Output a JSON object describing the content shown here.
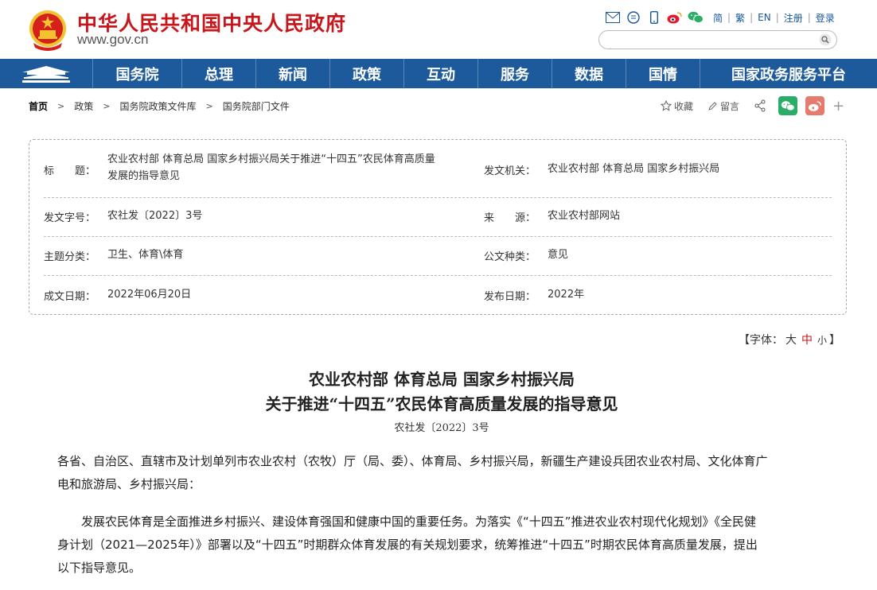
{
  "header": {
    "site_title": "中华人民共和国中央人民政府",
    "site_url": "www.gov.cn",
    "links": {
      "simplified": "简",
      "traditional": "繁",
      "english": "EN",
      "register": "注册",
      "login": "登录"
    },
    "search_placeholder": ""
  },
  "nav": {
    "items": [
      "国务院",
      "总理",
      "新闻",
      "政策",
      "互动",
      "服务",
      "数据",
      "国情",
      "国家政务服务平台"
    ]
  },
  "breadcrumb": {
    "items": [
      "首页",
      "政策",
      "国务院政策文件库",
      "国务院部门文件"
    ]
  },
  "share": {
    "favorite": "收藏",
    "comment": "留言"
  },
  "info": {
    "title_label": "标　　题：",
    "title_value_line1": "农业农村部 体育总局 国家乡村振兴局关于推进“十四五”农民体育高质量",
    "title_value_line2": "发展的指导意见",
    "issuer_label": "发文机关：",
    "issuer_value": "农业农村部 体育总局 国家乡村振兴局",
    "docno_label": "发文字号：",
    "docno_value": "农社发〔2022〕3号",
    "source_label": "来　　源：",
    "source_value": "农业农村部网站",
    "topic_label": "主题分类：",
    "topic_value": "卫生、体育\\体育",
    "doctype_label": "公文种类：",
    "doctype_value": "意见",
    "created_label": "成文日期：",
    "created_value": "2022年06月20日",
    "published_label": "发布日期：",
    "published_value": "2022年"
  },
  "font_size": {
    "prefix": "【字体：",
    "large": "大",
    "medium": "中",
    "small": "小",
    "suffix": "】"
  },
  "article": {
    "title_line1": "农业农村部 体育总局 国家乡村振兴局",
    "title_line2": "关于推进“十四五”农民体育高质量发展的指导意见",
    "doc_number": "农社发〔2022〕3号",
    "para1_line1": "各省、自治区、直辖市及计划单列市农业农村（农牧）厅（局、委）、体育局、乡村振兴局，新疆生产建设兵团农业农村局、文化体育广",
    "para1_line2": "电和旅游局、乡村振兴局：",
    "para2_line1": "　　发展农民体育是全面推进乡村振兴、建设体育强国和健康中国的重要任务。为落实《“十四五”推进农业农村现代化规划》《全民健",
    "para2_line2": "身计划（2021—2025年）》部署以及“十四五”时期群众体育发展的有关规划要求，统筹推进“十四五”时期农民体育高质量发展，提出",
    "para2_line3": "以下指导意见。"
  }
}
